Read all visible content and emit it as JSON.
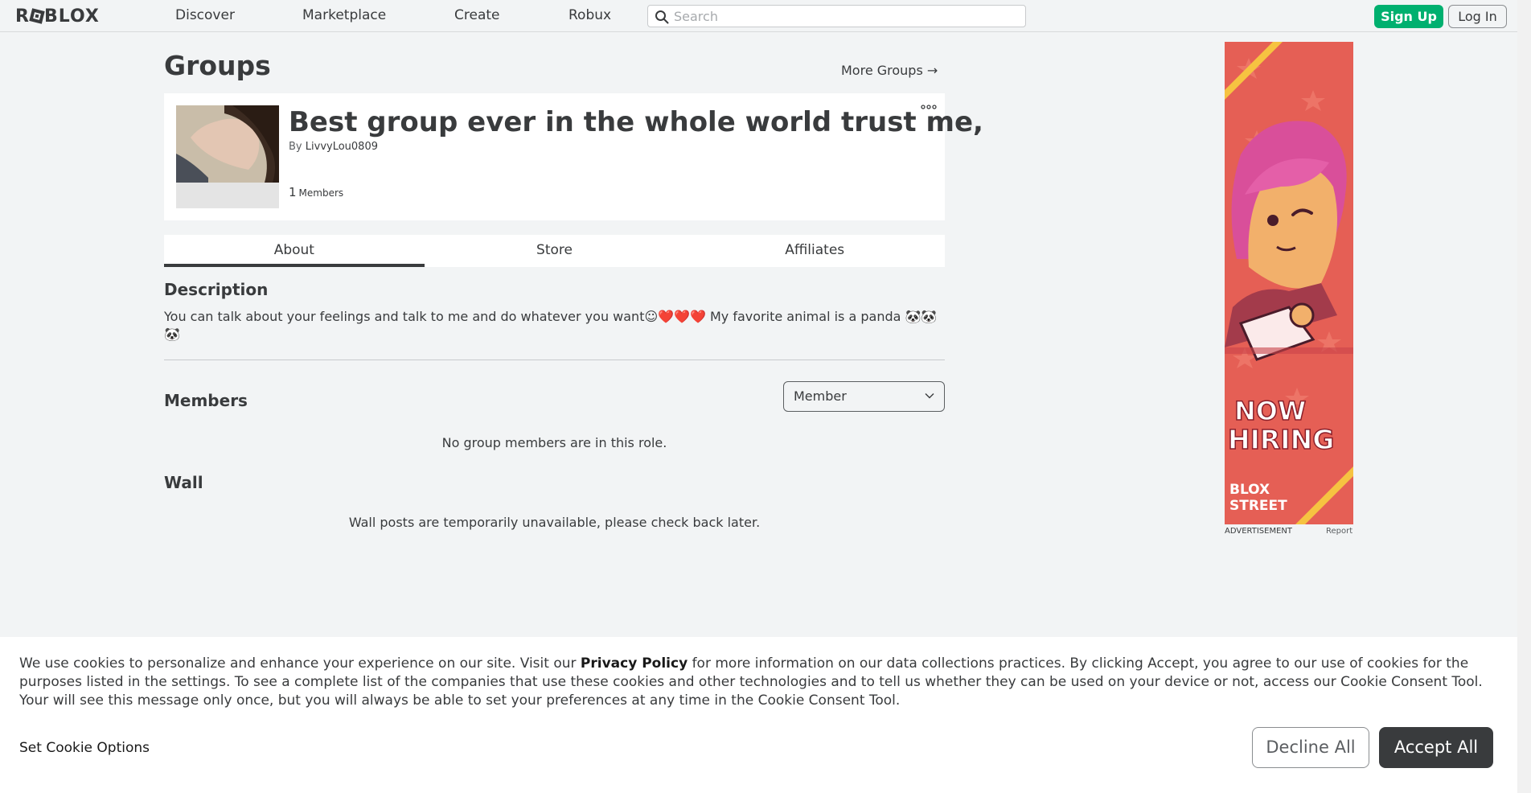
{
  "header": {
    "logo": "ROBLOX",
    "nav": [
      "Discover",
      "Marketplace",
      "Create",
      "Robux"
    ],
    "search_placeholder": "Search",
    "signup_label": "Sign Up",
    "login_label": "Log In"
  },
  "page": {
    "title": "Groups",
    "more_groups": "More Groups →"
  },
  "group": {
    "name": "Best group ever in the whole world trust me,",
    "by_label": "By",
    "owner": "LivvyLou0809",
    "member_count": "1",
    "members_label": "Members"
  },
  "tabs": [
    {
      "label": "About",
      "active": true
    },
    {
      "label": "Store",
      "active": false
    },
    {
      "label": "Affiliates",
      "active": false
    }
  ],
  "about": {
    "description_heading": "Description",
    "description": "You can talk about your feelings and talk to me and do whatever you want☺❤️❤️❤️ My favorite animal is a panda 🐼🐼🐼",
    "members_heading": "Members",
    "role_selected": "Member",
    "members_empty": "No group members are in this role.",
    "wall_heading": "Wall",
    "wall_message": "Wall posts are temporarily unavailable, please check back later."
  },
  "ad": {
    "headline_line1": "NOW",
    "headline_line2": "HIRING",
    "brand_line1": "BLOX",
    "brand_line2": "STREET",
    "label": "ADVERTISEMENT",
    "report": "Report"
  },
  "cookie_banner": {
    "text_before": "We use cookies to personalize and enhance your experience on our site. Visit our ",
    "privacy_link": "Privacy Policy",
    "text_after": " for more information on our data collections practices. By clicking Accept, you agree to our use of cookies for the purposes listed in the settings. To see a complete list of the companies that use these cookies and other technologies and to tell us whether they can be used on your device or not, access our Cookie Consent Tool. Your will see this message only once, but you will always be able to set your preferences at any time in the Cookie Consent Tool.",
    "options_label": "Set Cookie Options",
    "decline_label": "Decline All",
    "accept_label": "Accept All"
  },
  "colors": {
    "signup_green": "#00b06f",
    "text_dark": "#393b3d",
    "ad_red": "#e55f55",
    "page_bg": "#f2f4f5"
  }
}
